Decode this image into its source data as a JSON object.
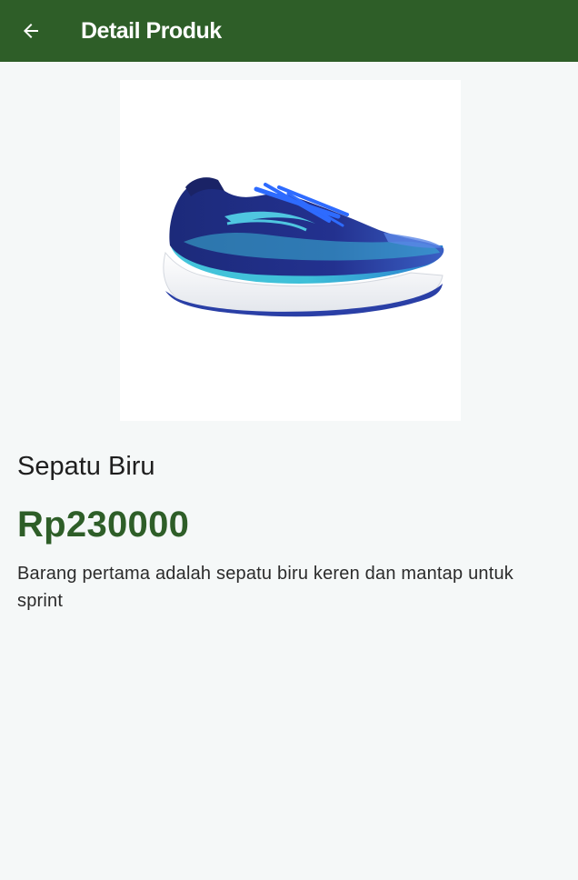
{
  "appbar": {
    "title": "Detail Produk",
    "back_icon": "arrow-left-icon",
    "background_color": "#2e5e28"
  },
  "product": {
    "image_alt_icon": "shoe-image",
    "name": "Sepatu Biru",
    "price": "Rp230000",
    "description": "Barang pertama adalah sepatu biru keren dan mantap untuk sprint",
    "price_color": "#2e5e28"
  }
}
